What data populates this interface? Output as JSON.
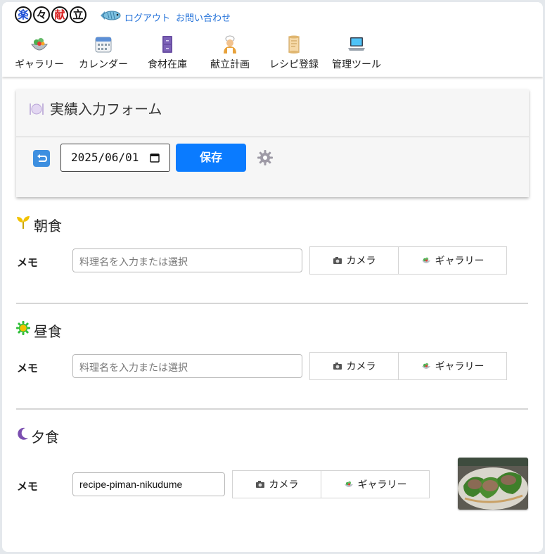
{
  "logo": {
    "chars": [
      "楽",
      "々",
      "献",
      "立"
    ]
  },
  "toplinks": {
    "logout": "ログアウト",
    "contact": "お問い合わせ"
  },
  "nav": {
    "items": [
      {
        "label": "ギャラリー",
        "icon": "salad-icon"
      },
      {
        "label": "カレンダー",
        "icon": "calendar-icon"
      },
      {
        "label": "食材在庫",
        "icon": "cabinet-icon"
      },
      {
        "label": "献立計画",
        "icon": "chef-icon"
      },
      {
        "label": "レシピ登録",
        "icon": "scroll-icon"
      },
      {
        "label": "管理ツール",
        "icon": "laptop-icon"
      }
    ]
  },
  "form": {
    "title": "実績入力フォーム",
    "date_value": "2025/06/01",
    "save_label": "保存"
  },
  "meals": [
    {
      "title": "朝食",
      "icon": "sprout-icon",
      "memo_label": "メモ",
      "input_placeholder": "料理名を入力または選択",
      "input_value": "",
      "camera_label": "カメラ",
      "gallery_label": "ギャラリー"
    },
    {
      "title": "昼食",
      "icon": "sun-icon",
      "memo_label": "メモ",
      "input_placeholder": "料理名を入力または選択",
      "input_value": "",
      "camera_label": "カメラ",
      "gallery_label": "ギャラリー"
    },
    {
      "title": "夕食",
      "icon": "moon-icon",
      "memo_label": "メモ",
      "input_placeholder": "",
      "input_value": "recipe-piman-nikudume",
      "camera_label": "カメラ",
      "gallery_label": "ギャラリー"
    }
  ],
  "colors": {
    "accent": "#0a7bff",
    "link": "#2472d9"
  }
}
